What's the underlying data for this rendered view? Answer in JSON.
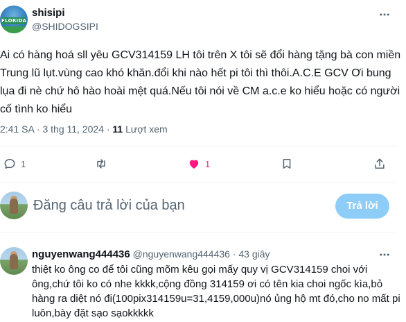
{
  "tweet": {
    "author_name": "shisipi",
    "author_handle": "@SHIDOGSIPI",
    "avatar_text": "FLORIDA",
    "text": "Ai có hàng hoá sll yêu GCV314159 LH tôi trên X tôi sẽ đổi hàng tặng bà con miền Trung lũ lụt.vùng cao khó khăn.đổi khi nào hết pi tôi thì thôi.A.C.E GCV Ơi bung lụa đi nè chứ hô hào hoài mệt quá.Nếu tôi nói về CM a.c.e ko hiểu hoặc có người cố tình ko hiểu",
    "time": "2:41 SA · 3 thg 11, 2024 · ",
    "views_count": "11",
    "views_label": " Lượt xem"
  },
  "actions": {
    "reply_count": "1",
    "retweet_count": "",
    "like_count": "1"
  },
  "compose": {
    "placeholder": "Đăng câu trả lời của bạn",
    "button_label": "Trả lời"
  },
  "reply": {
    "author_name": "nguyenwang444436",
    "author_handle_time": " @nguyenwang444436 · 43 giây",
    "text": "thiệt ko ông co để tôi cũng mõm kêu gọi mấy quy vị GCV314159 choi với ông,chứ tôi ko có nhe kkkk,cộng đồng 314159 ơi có tên kia choi ngốc kìa,bỏ hàng ra diệt nó đi(100pix314159u=31,4159,000u)nó ủng hộ mt đó,cho no mất pi luôn,bày đặt sạo sạokkkkk"
  },
  "colors": {
    "like": "#f91880",
    "muted": "#536471",
    "reply_button": "#8ecdf8"
  }
}
